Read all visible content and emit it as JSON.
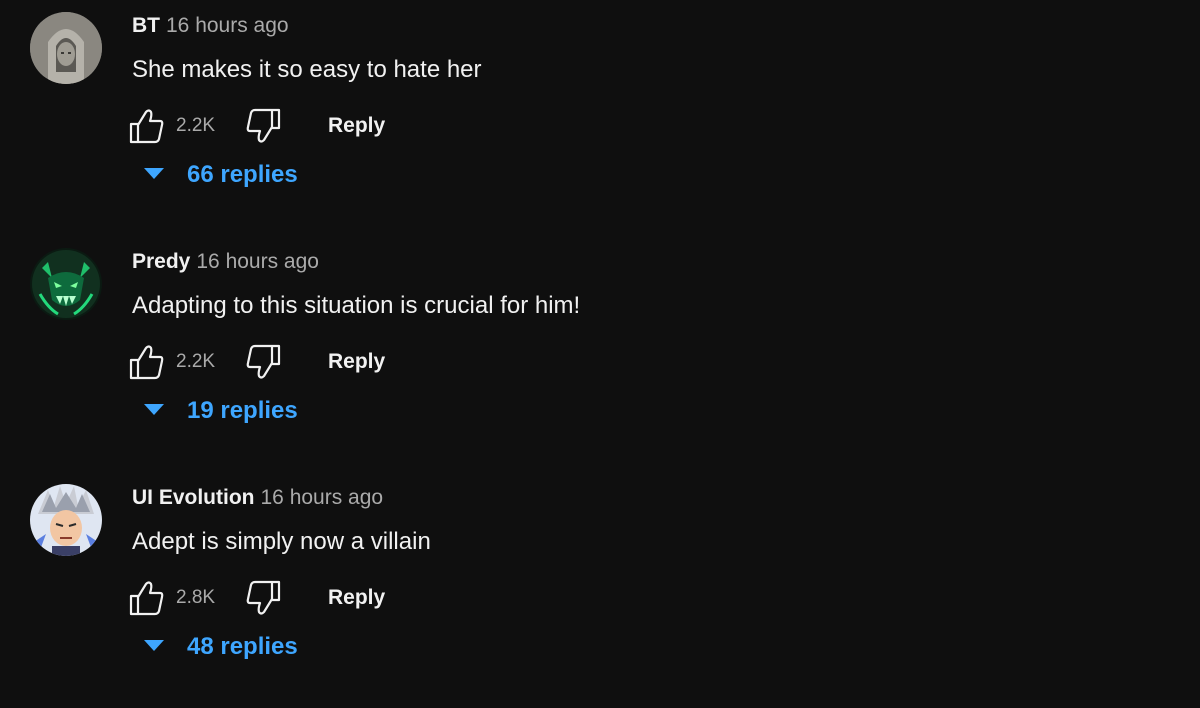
{
  "comments": [
    {
      "author": "BT",
      "time": "16 hours ago",
      "text": "She makes it so easy to hate her",
      "likes": "2.2K",
      "reply_label": "Reply",
      "replies_label": "66 replies",
      "avatar_icon": "statue-avatar-icon"
    },
    {
      "author": "Predy",
      "time": "16 hours ago",
      "text": "Adapting to this situation is crucial for him!",
      "likes": "2.2K",
      "reply_label": "Reply",
      "replies_label": "19 replies",
      "avatar_icon": "green-monster-avatar-icon"
    },
    {
      "author": "UI Evolution",
      "time": "16 hours ago",
      "text": "Adept is simply now a villain",
      "likes": "2.8K",
      "reply_label": "Reply",
      "replies_label": "48 replies",
      "avatar_icon": "anime-character-avatar-icon"
    }
  ],
  "colors": {
    "background": "#0f0f0f",
    "primary_text": "#f1f1f1",
    "secondary_text": "#aaaaaa",
    "link_blue": "#3ea6ff"
  }
}
